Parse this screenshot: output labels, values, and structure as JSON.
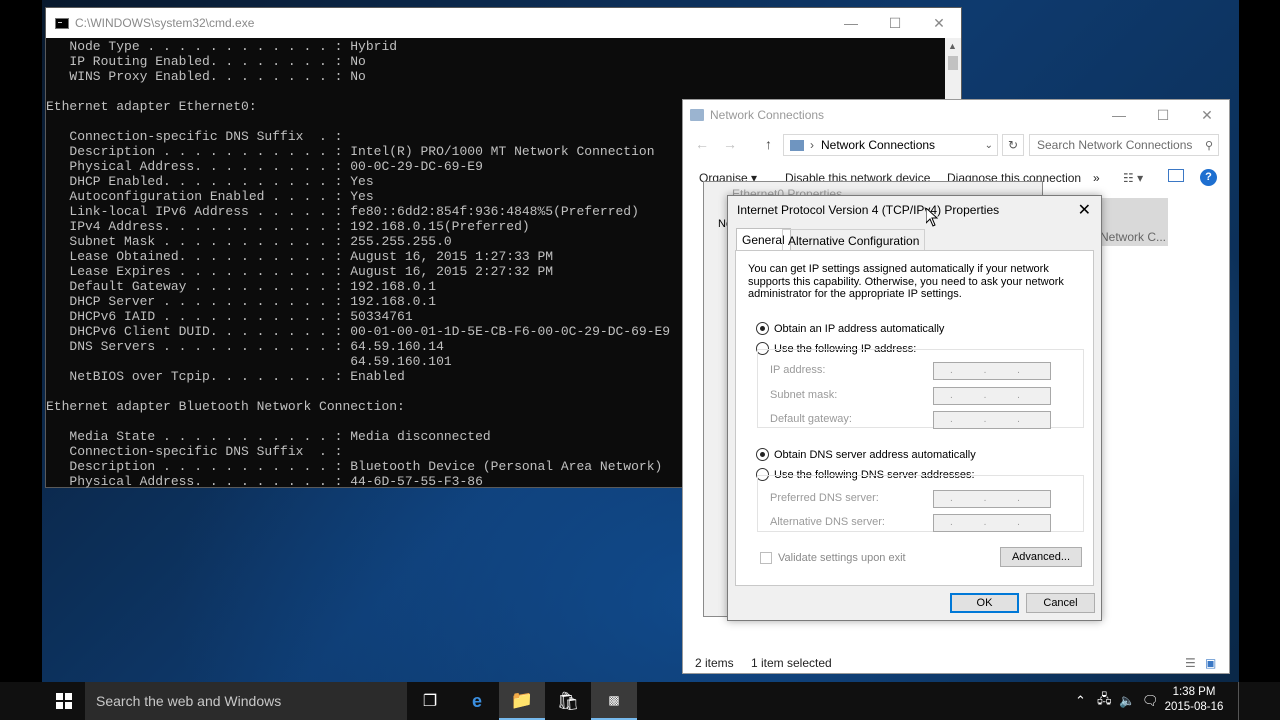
{
  "cmd": {
    "title": "C:\\WINDOWS\\system32\\cmd.exe",
    "lines": [
      "   Node Type . . . . . . . . . . . . : Hybrid",
      "   IP Routing Enabled. . . . . . . . : No",
      "   WINS Proxy Enabled. . . . . . . . : No",
      "",
      "Ethernet adapter Ethernet0:",
      "",
      "   Connection-specific DNS Suffix  . :",
      "   Description . . . . . . . . . . . : Intel(R) PRO/1000 MT Network Connection",
      "   Physical Address. . . . . . . . . : 00-0C-29-DC-69-E9",
      "   DHCP Enabled. . . . . . . . . . . : Yes",
      "   Autoconfiguration Enabled . . . . : Yes",
      "   Link-local IPv6 Address . . . . . : fe80::6dd2:854f:936:4848%5(Preferred)",
      "   IPv4 Address. . . . . . . . . . . : 192.168.0.15(Preferred)",
      "   Subnet Mask . . . . . . . . . . . : 255.255.255.0",
      "   Lease Obtained. . . . . . . . . . : August 16, 2015 1:27:33 PM",
      "   Lease Expires . . . . . . . . . . : August 16, 2015 2:27:32 PM",
      "   Default Gateway . . . . . . . . . : 192.168.0.1",
      "   DHCP Server . . . . . . . . . . . : 192.168.0.1",
      "   DHCPv6 IAID . . . . . . . . . . . : 50334761",
      "   DHCPv6 Client DUID. . . . . . . . : 00-01-00-01-1D-5E-CB-F6-00-0C-29-DC-69-E9",
      "   DNS Servers . . . . . . . . . . . : 64.59.160.14",
      "                                       64.59.160.101",
      "   NetBIOS over Tcpip. . . . . . . . : Enabled",
      "",
      "Ethernet adapter Bluetooth Network Connection:",
      "",
      "   Media State . . . . . . . . . . . : Media disconnected",
      "   Connection-specific DNS Suffix  . :",
      "   Description . . . . . . . . . . . : Bluetooth Device (Personal Area Network)",
      "   Physical Address. . . . . . . . . : 44-6D-57-55-F3-86"
    ]
  },
  "network_connections": {
    "title": "Network Connections",
    "breadcrumb": "Network Connections",
    "search_placeholder": "Search Network Connections",
    "toolbar": {
      "organise": "Organise ▾",
      "disable": "Disable this network device",
      "diagnose": "Diagnose this connection",
      "more": "»"
    },
    "selected_item_label": "Network C...",
    "status": {
      "items": "2 items",
      "selected": "1 item selected"
    }
  },
  "ethernet_props": {
    "title": "Ethernet0 Properties",
    "partial_label": "Ne"
  },
  "ipv4_dialog": {
    "title": "Internet Protocol Version 4 (TCP/IPv4) Properties",
    "tabs": [
      "General",
      "Alternative Configuration"
    ],
    "intro": "You can get IP settings assigned automatically if your network supports this capability. Otherwise, you need to ask your network administrator for the appropriate IP settings.",
    "obtain_ip_auto": "Obtain an IP address automatically",
    "use_following_ip": "Use the following IP address:",
    "ip_address_label": "IP address:",
    "subnet_mask_label": "Subnet mask:",
    "default_gateway_label": "Default gateway:",
    "obtain_dns_auto": "Obtain DNS server address automatically",
    "use_following_dns": "Use the following DNS server addresses:",
    "preferred_dns_label": "Preferred DNS server:",
    "alternative_dns_label": "Alternative DNS server:",
    "validate_label": "Validate settings upon exit",
    "advanced_button": "Advanced...",
    "ok_button": "OK",
    "cancel_button": "Cancel",
    "ip_placeholder": ". . ."
  },
  "taskbar": {
    "search_placeholder": "Search the web and Windows",
    "time": "1:38 PM",
    "date": "2015-08-16"
  },
  "colors": {
    "accent": "#0078d7",
    "cmd_text": "#c0c0c0",
    "cmd_bg": "#0c0c0c"
  }
}
